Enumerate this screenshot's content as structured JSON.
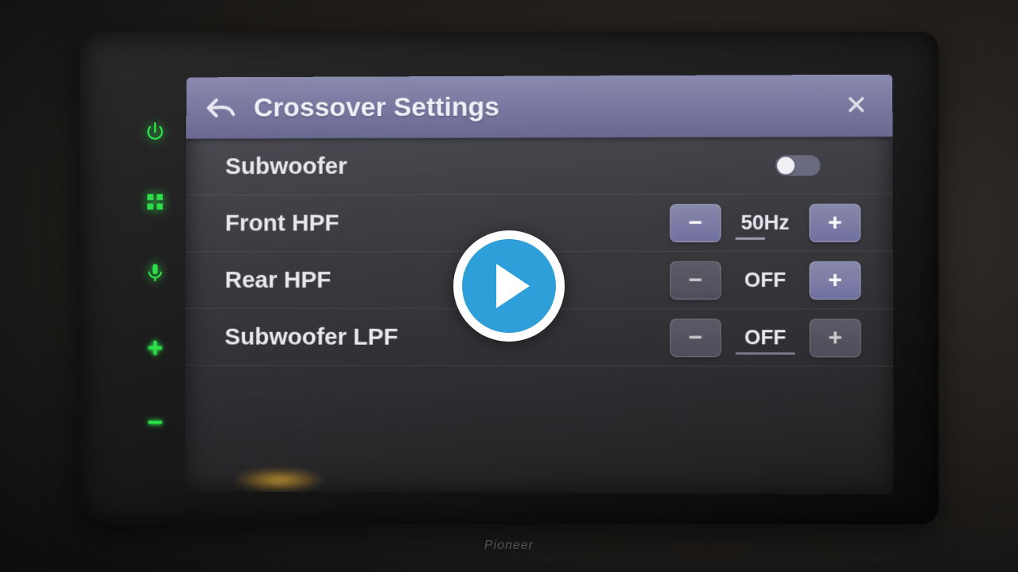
{
  "header": {
    "title": "Crossover Settings"
  },
  "brand": "Pioneer",
  "rows": {
    "subwoofer": {
      "label": "Subwoofer"
    },
    "front_hpf": {
      "label": "Front HPF",
      "value": "50Hz"
    },
    "rear_hpf": {
      "label": "Rear HPF",
      "value": "OFF"
    },
    "sub_lpf": {
      "label": "Subwoofer LPF",
      "value": "OFF"
    }
  },
  "glyphs": {
    "minus": "−",
    "plus": "+",
    "close": "✕"
  },
  "side": {
    "plus": "+",
    "minus": "−"
  }
}
